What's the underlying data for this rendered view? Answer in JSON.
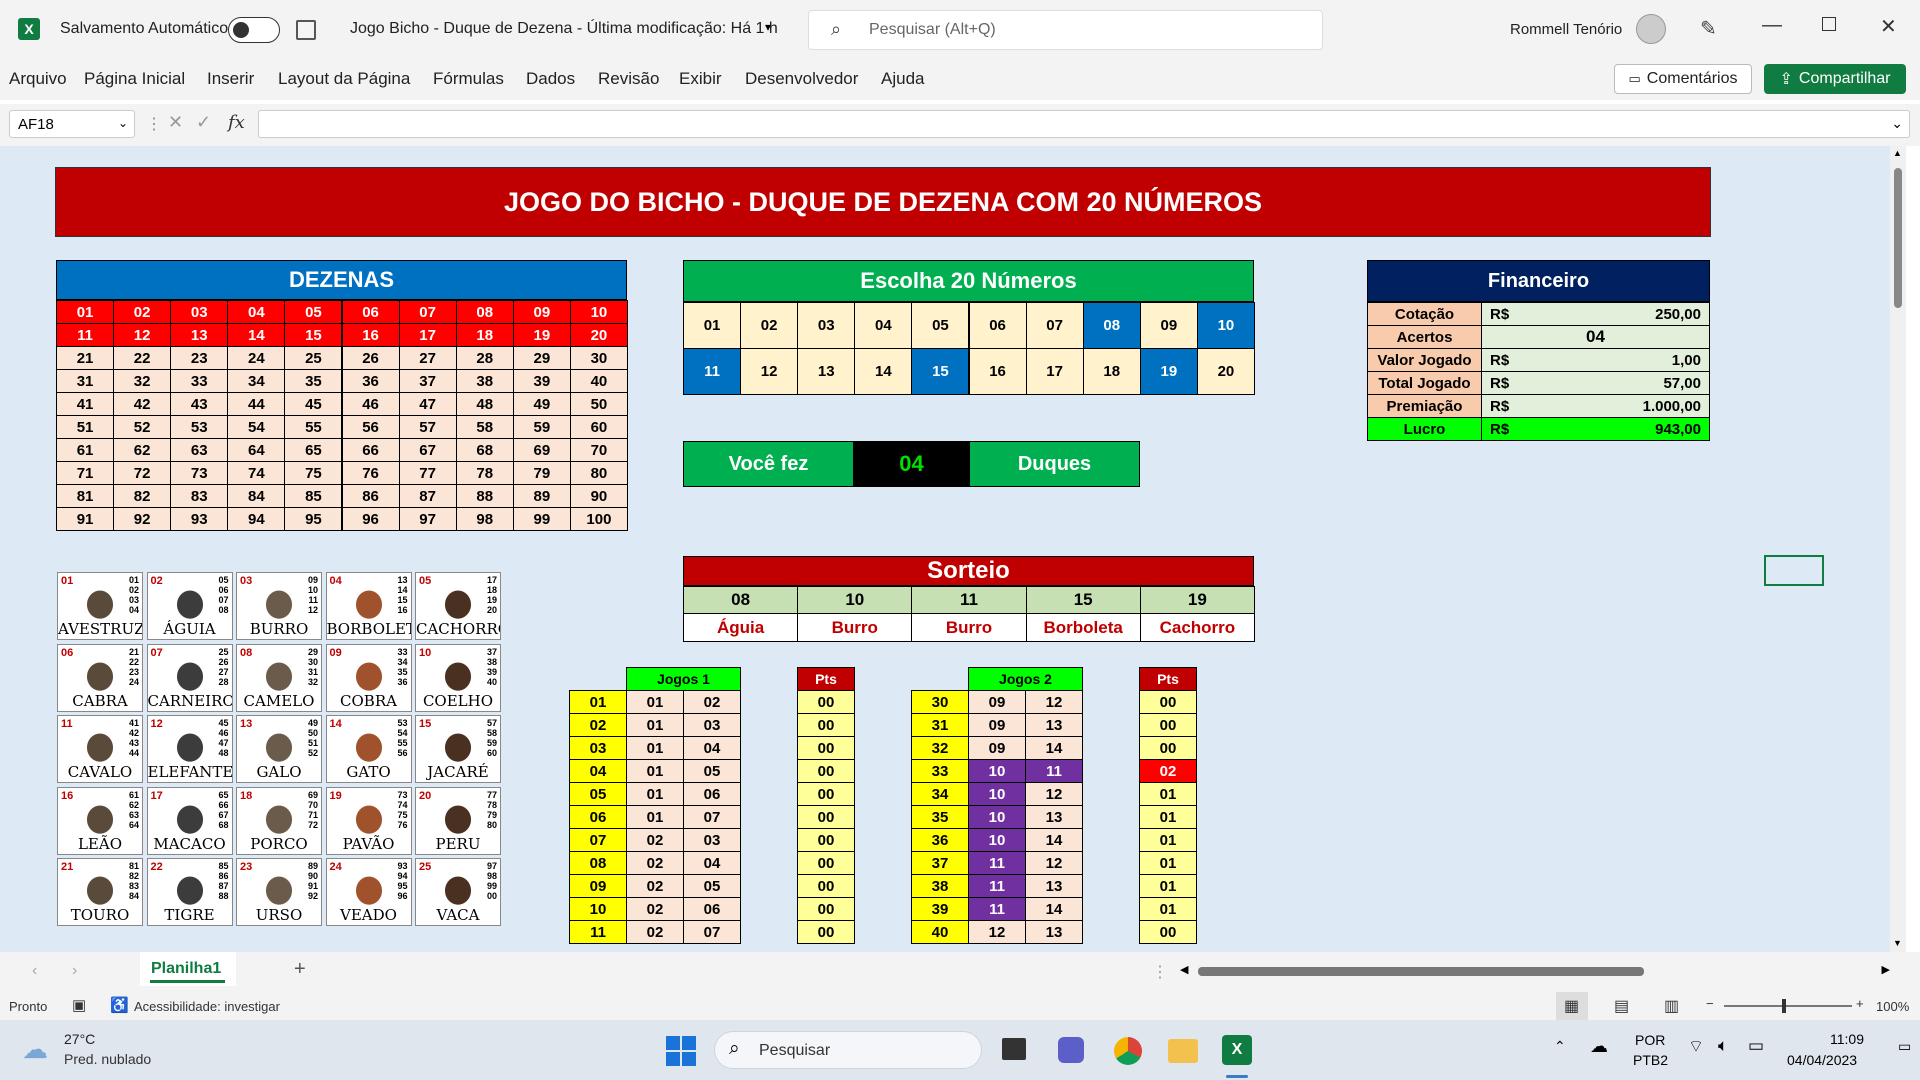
{
  "titlebar": {
    "autosave_label": "Salvamento Automático",
    "doc_title": "Jogo Bicho - Duque de Dezena  -  Última modificação: Há 1 h",
    "search_placeholder": "Pesquisar (Alt+Q)",
    "user_name": "Rommell Tenório"
  },
  "menu": [
    "Arquivo",
    "Página Inicial",
    "Inserir",
    "Layout da Página",
    "Fórmulas",
    "Dados",
    "Revisão",
    "Exibir",
    "Desenvolvedor",
    "Ajuda"
  ],
  "buttons": {
    "comments": "Comentários",
    "share": "Compartilhar"
  },
  "formula": {
    "name_box": "AF18",
    "fx": "fx",
    "value": ""
  },
  "sheet": {
    "title": "JOGO DO BICHO - DUQUE DE DEZENA COM 20 NÚMEROS",
    "dezenas_title": "DEZENAS",
    "escolha_title": "Escolha 20 Números",
    "escolha": [
      "01",
      "02",
      "03",
      "04",
      "05",
      "06",
      "07",
      "08",
      "09",
      "10",
      "11",
      "12",
      "13",
      "14",
      "15",
      "16",
      "17",
      "18",
      "19",
      "20"
    ],
    "escolha_highlight": [
      "08",
      "10",
      "11",
      "15",
      "19"
    ],
    "fin": {
      "title": "Financeiro",
      "rows": [
        {
          "label": "Cotação",
          "cur": "R$",
          "value": "250,00"
        },
        {
          "label": "Acertos",
          "cur": "",
          "value": "04"
        },
        {
          "label": "Valor Jogado",
          "cur": "R$",
          "value": "1,00"
        },
        {
          "label": "Total Jogado",
          "cur": "R$",
          "value": "57,00"
        },
        {
          "label": "Premiação",
          "cur": "R$",
          "value": "1.000,00"
        },
        {
          "label": "Lucro",
          "cur": "R$",
          "value": "943,00"
        }
      ]
    },
    "voce_fez": {
      "label": "Você fez",
      "value": "04",
      "unit": "Duques"
    },
    "sorteio": {
      "title": "Sorteio",
      "numbers": [
        "08",
        "10",
        "11",
        "15",
        "19"
      ],
      "animals": [
        "Águia",
        "Burro",
        "Burro",
        "Borboleta",
        "Cachorro"
      ]
    },
    "animals": [
      {
        "n": "01",
        "name": "AVESTRUZ",
        "d": [
          "01",
          "02",
          "03",
          "04"
        ]
      },
      {
        "n": "02",
        "name": "ÁGUIA",
        "d": [
          "05",
          "06",
          "07",
          "08"
        ]
      },
      {
        "n": "03",
        "name": "BURRO",
        "d": [
          "09",
          "10",
          "11",
          "12"
        ]
      },
      {
        "n": "04",
        "name": "BORBOLETA",
        "d": [
          "13",
          "14",
          "15",
          "16"
        ]
      },
      {
        "n": "05",
        "name": "CACHORRO",
        "d": [
          "17",
          "18",
          "19",
          "20"
        ]
      },
      {
        "n": "06",
        "name": "CABRA",
        "d": [
          "21",
          "22",
          "23",
          "24"
        ]
      },
      {
        "n": "07",
        "name": "CARNEIRO",
        "d": [
          "25",
          "26",
          "27",
          "28"
        ]
      },
      {
        "n": "08",
        "name": "CAMELO",
        "d": [
          "29",
          "30",
          "31",
          "32"
        ]
      },
      {
        "n": "09",
        "name": "COBRA",
        "d": [
          "33",
          "34",
          "35",
          "36"
        ]
      },
      {
        "n": "10",
        "name": "COELHO",
        "d": [
          "37",
          "38",
          "39",
          "40"
        ]
      },
      {
        "n": "11",
        "name": "CAVALO",
        "d": [
          "41",
          "42",
          "43",
          "44"
        ]
      },
      {
        "n": "12",
        "name": "ELEFANTE",
        "d": [
          "45",
          "46",
          "47",
          "48"
        ]
      },
      {
        "n": "13",
        "name": "GALO",
        "d": [
          "49",
          "50",
          "51",
          "52"
        ]
      },
      {
        "n": "14",
        "name": "GATO",
        "d": [
          "53",
          "54",
          "55",
          "56"
        ]
      },
      {
        "n": "15",
        "name": "JACARÉ",
        "d": [
          "57",
          "58",
          "59",
          "60"
        ]
      },
      {
        "n": "16",
        "name": "LEÃO",
        "d": [
          "61",
          "62",
          "63",
          "64"
        ]
      },
      {
        "n": "17",
        "name": "MACACO",
        "d": [
          "65",
          "66",
          "67",
          "68"
        ]
      },
      {
        "n": "18",
        "name": "PORCO",
        "d": [
          "69",
          "70",
          "71",
          "72"
        ]
      },
      {
        "n": "19",
        "name": "PAVÃO",
        "d": [
          "73",
          "74",
          "75",
          "76"
        ]
      },
      {
        "n": "20",
        "name": "PERU",
        "d": [
          "77",
          "78",
          "79",
          "80"
        ]
      },
      {
        "n": "21",
        "name": "TOURO",
        "d": [
          "81",
          "82",
          "83",
          "84"
        ]
      },
      {
        "n": "22",
        "name": "TIGRE",
        "d": [
          "85",
          "86",
          "87",
          "88"
        ]
      },
      {
        "n": "23",
        "name": "URSO",
        "d": [
          "89",
          "90",
          "91",
          "92"
        ]
      },
      {
        "n": "24",
        "name": "VEADO",
        "d": [
          "93",
          "94",
          "95",
          "96"
        ]
      },
      {
        "n": "25",
        "name": "VACA",
        "d": [
          "97",
          "98",
          "99",
          "00"
        ]
      }
    ],
    "jogos1": {
      "title": "Jogos 1",
      "pts_title": "Pts",
      "rows": [
        [
          "01",
          "01",
          "02",
          "00"
        ],
        [
          "02",
          "01",
          "03",
          "00"
        ],
        [
          "03",
          "01",
          "04",
          "00"
        ],
        [
          "04",
          "01",
          "05",
          "00"
        ],
        [
          "05",
          "01",
          "06",
          "00"
        ],
        [
          "06",
          "01",
          "07",
          "00"
        ],
        [
          "07",
          "02",
          "03",
          "00"
        ],
        [
          "08",
          "02",
          "04",
          "00"
        ],
        [
          "09",
          "02",
          "05",
          "00"
        ],
        [
          "10",
          "02",
          "06",
          "00"
        ],
        [
          "11",
          "02",
          "07",
          "00"
        ]
      ]
    },
    "jogos2": {
      "title": "Jogos 2",
      "pts_title": "Pts",
      "rows": [
        [
          "30",
          "09",
          "12",
          "00"
        ],
        [
          "31",
          "09",
          "13",
          "00"
        ],
        [
          "32",
          "09",
          "14",
          "00"
        ],
        [
          "33",
          "10",
          "11",
          "02"
        ],
        [
          "34",
          "10",
          "12",
          "01"
        ],
        [
          "35",
          "10",
          "13",
          "01"
        ],
        [
          "36",
          "10",
          "14",
          "01"
        ],
        [
          "37",
          "11",
          "12",
          "01"
        ],
        [
          "38",
          "11",
          "13",
          "01"
        ],
        [
          "39",
          "11",
          "14",
          "01"
        ],
        [
          "40",
          "12",
          "13",
          "00"
        ]
      ]
    }
  },
  "tabs": {
    "sheet1": "Planilha1"
  },
  "status": {
    "ready": "Pronto",
    "accessibility": "Acessibilidade: investigar",
    "zoom": "100%"
  },
  "taskbar": {
    "weather_temp": "27°C",
    "weather_desc": "Pred. nublado",
    "search": "Pesquisar",
    "lang1": "POR",
    "lang2": "PTB2",
    "time": "11:09",
    "date": "04/04/2023"
  },
  "colors": {
    "excel_green": "#107c41",
    "title_red": "#c00000",
    "header_blue": "#0070c0",
    "green": "#00b050",
    "navy": "#002060",
    "purple": "#7030a0"
  }
}
